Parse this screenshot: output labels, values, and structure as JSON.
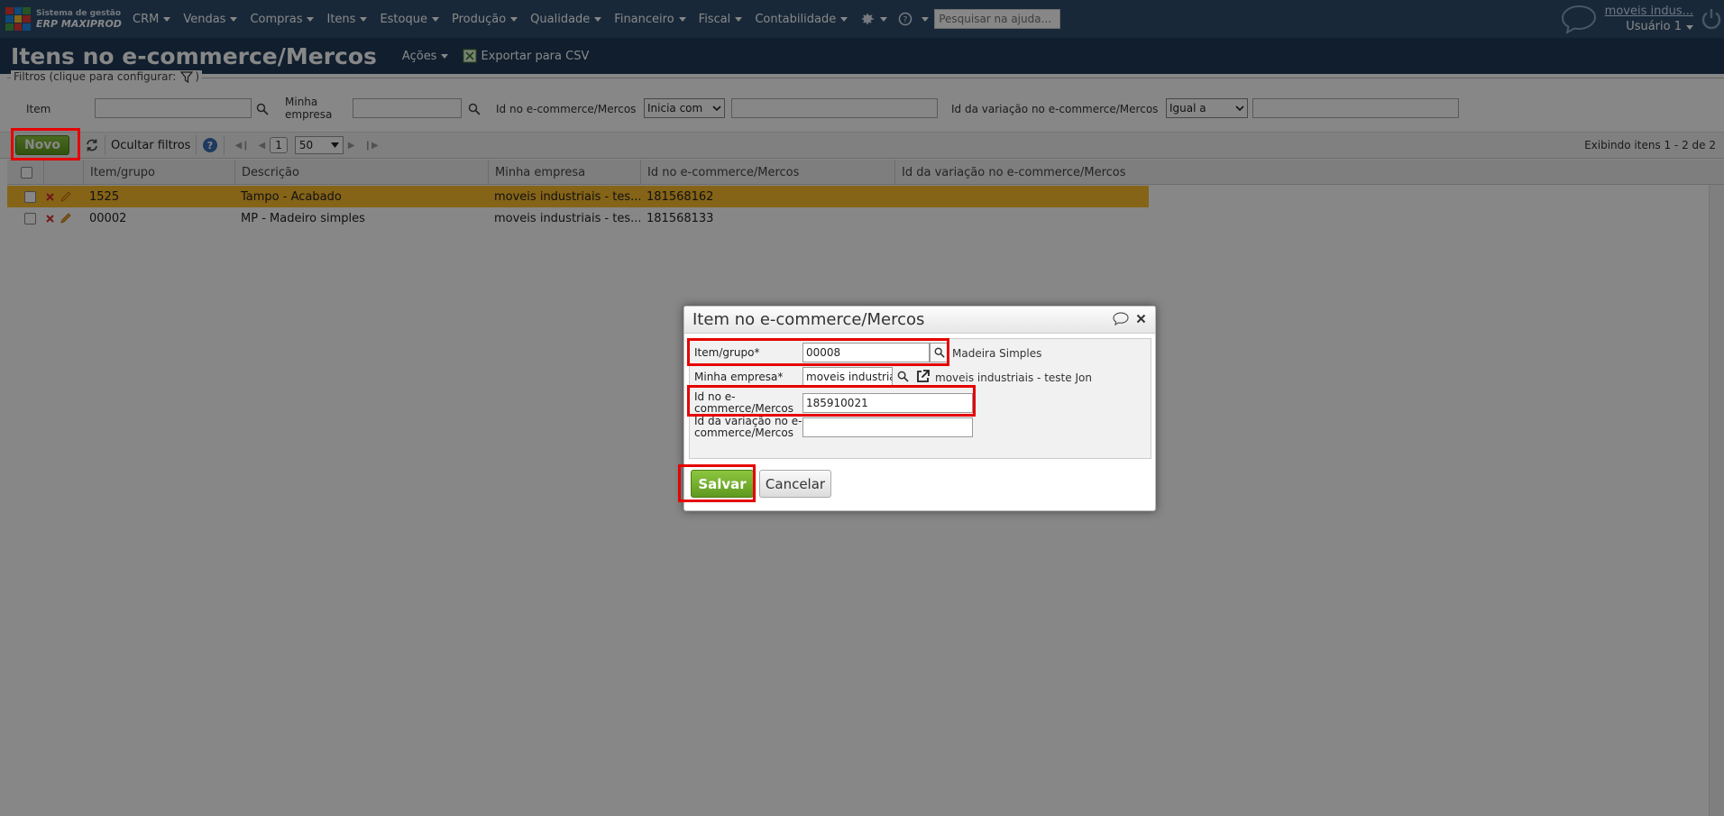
{
  "app": {
    "logo_line1": "Sistema de gestão",
    "logo_line2": "ERP MAXIPROD",
    "menu": [
      {
        "label": "CRM"
      },
      {
        "label": "Vendas"
      },
      {
        "label": "Compras"
      },
      {
        "label": "Itens"
      },
      {
        "label": "Estoque"
      },
      {
        "label": "Produção"
      },
      {
        "label": "Qualidade"
      },
      {
        "label": "Financeiro"
      },
      {
        "label": "Fiscal"
      },
      {
        "label": "Contabilidade"
      }
    ],
    "help_search_placeholder": "Pesquisar na ajuda...",
    "company_link": "moveis indus...",
    "user_label": "Usuário 1"
  },
  "page": {
    "title": "Itens no e-commerce/Mercos",
    "actions_label": "Ações",
    "export_label": "Exportar para CSV"
  },
  "filters": {
    "legend": "Filtros (clique para configurar:",
    "legend_close": ")",
    "item_label": "Item",
    "empresa_label_1": "Minha",
    "empresa_label_2": "empresa",
    "id_ecommerce_label": "Id no e-commerce/Mercos",
    "id_ecommerce_op": "Inicia com",
    "id_variacao_label": "Id da variação no e-commerce/Mercos",
    "id_variacao_op": "Igual a"
  },
  "toolbar": {
    "novo_label": "Novo",
    "ocultar_filtros_label": "Ocultar filtros",
    "page_number": "1",
    "page_size": "50",
    "pager_info": "Exibindo itens 1 - 2 de 2"
  },
  "grid": {
    "columns": [
      "Item/grupo",
      "Descrição",
      "Minha empresa",
      "Id no e-commerce/Mercos",
      "Id da variação no e-commerce/Mercos"
    ],
    "rows": [
      {
        "item": "1525",
        "descricao": "Tampo - Acabado",
        "empresa": "moveis industriais - tes...",
        "id_ecommerce": "181568162",
        "id_variacao": ""
      },
      {
        "item": "00002",
        "descricao": "MP - Madeiro simples",
        "empresa": "moveis industriais - tes...",
        "id_ecommerce": "181568133",
        "id_variacao": ""
      }
    ]
  },
  "dialog": {
    "title": "Item no e-commerce/Mercos",
    "item_label": "Item/grupo*",
    "item_value": "00008",
    "item_desc": "Madeira Simples",
    "empresa_label": "Minha empresa*",
    "empresa_value": "moveis industriais -",
    "empresa_desc": "moveis industriais - teste Jon",
    "id_label_1": "Id no e-",
    "id_label_2": "commerce/Mercos",
    "id_value": "185910021",
    "var_label_1": "Id da variação no e-",
    "var_label_2": "commerce/Mercos",
    "var_value": "",
    "salvar_label": "Salvar",
    "cancelar_label": "Cancelar"
  },
  "colors": {
    "nav_bg": "#2f4d6c",
    "title_bg": "#1f3a58",
    "selected_row": "#fbbc2d",
    "primary_button": "#6aa82a",
    "highlight": "#e60000"
  }
}
